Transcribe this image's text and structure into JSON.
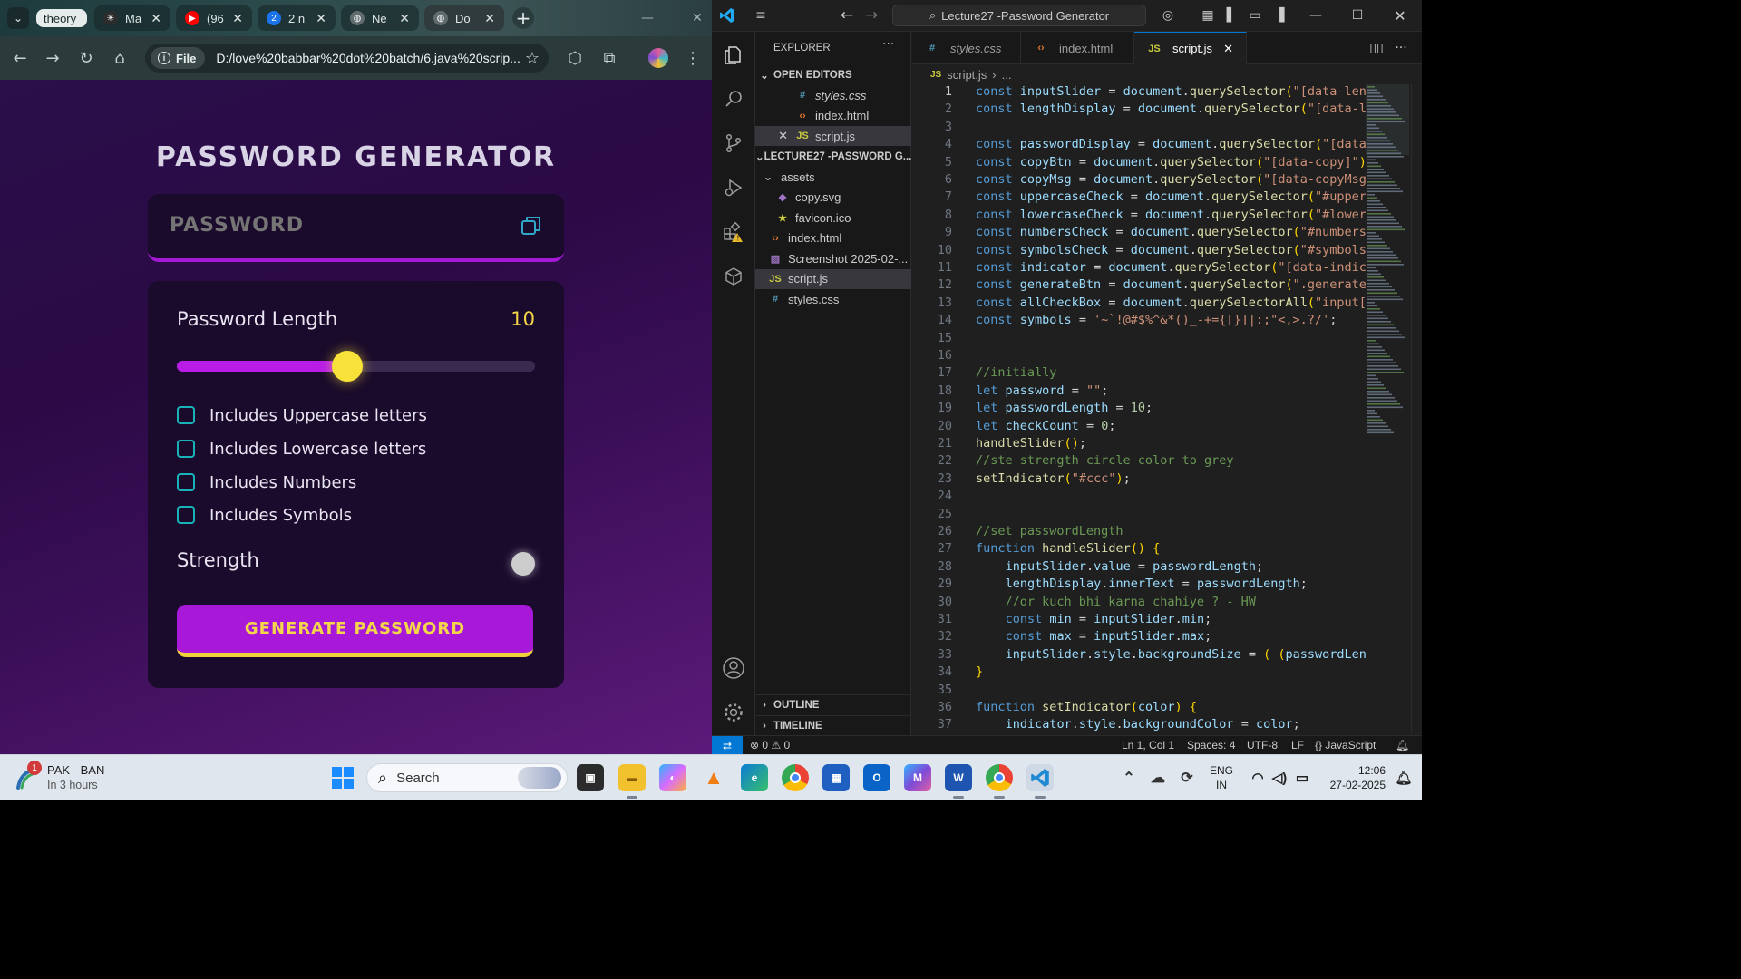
{
  "browser": {
    "tabs": [
      {
        "label": "theory",
        "type": "group"
      },
      {
        "label": "Ma",
        "icon": "openai-icon"
      },
      {
        "label": "(96",
        "icon": "youtube-icon"
      },
      {
        "label": "2 n",
        "icon": "count-badge-icon",
        "badge": "2"
      },
      {
        "label": "Ne",
        "icon": "globe-icon"
      },
      {
        "label": "Do",
        "icon": "globe-icon",
        "active": true
      }
    ],
    "omnibox": {
      "scheme_chip": "File",
      "url": "D:/love%20babbar%20dot%20batch/6.java%20scrip..."
    }
  },
  "app": {
    "title": "PASSWORD GENERATOR",
    "password_placeholder": "PASSWORD",
    "length_label": "Password Length",
    "length_value": "10",
    "slider_fraction": 0.475,
    "options": [
      {
        "label": "Includes Uppercase letters",
        "checked": false
      },
      {
        "label": "Includes Lowercase letters",
        "checked": false
      },
      {
        "label": "Includes Numbers",
        "checked": false
      },
      {
        "label": "Includes Symbols",
        "checked": false
      }
    ],
    "strength_label": "Strength",
    "strength_color": "#cccccc",
    "generate_label": "GENERATE PASSWORD"
  },
  "vscode": {
    "search": "Lecture27 -Password Generator",
    "explorer_title": "EXPLORER",
    "open_editors_label": "OPEN EDITORS",
    "open_editors": [
      {
        "name": "styles.css",
        "icon": "#",
        "italic": true
      },
      {
        "name": "index.html",
        "icon": "<>"
      },
      {
        "name": "script.js",
        "icon": "JS",
        "selected": true
      }
    ],
    "folder_label": "LECTURE27 -PASSWORD G...",
    "tree": [
      {
        "name": "assets",
        "folder": true
      },
      {
        "name": "copy.svg",
        "icon": "svg"
      },
      {
        "name": "favicon.ico",
        "icon": "star"
      },
      {
        "name": "index.html",
        "icon": "<>"
      },
      {
        "name": "Screenshot 2025-02-...",
        "icon": "img"
      },
      {
        "name": "script.js",
        "icon": "JS",
        "selected": true
      },
      {
        "name": "styles.css",
        "icon": "#"
      }
    ],
    "outline_label": "OUTLINE",
    "timeline_label": "TIMELINE",
    "editor_tabs": [
      {
        "name": "styles.css",
        "icon": "#"
      },
      {
        "name": "index.html",
        "icon": "<>"
      },
      {
        "name": "script.js",
        "icon": "JS",
        "active": true
      }
    ],
    "breadcrumb": [
      "script.js",
      "..."
    ],
    "code_lines": [
      "const inputSlider = document.querySelector(\"[data-leng",
      "const lengthDisplay = document.querySelector(\"[data-le",
      "",
      "const passwordDisplay = document.querySelector(\"[data-",
      "const copyBtn = document.querySelector(\"[data-copy]\");",
      "const copyMsg = document.querySelector(\"[data-copyMsg]",
      "const uppercaseCheck = document.querySelector(\"#upperc",
      "const lowercaseCheck = document.querySelector(\"#lowerc",
      "const numbersCheck = document.querySelector(\"#numbers\"",
      "const symbolsCheck = document.querySelector(\"#symbols\"",
      "const indicator = document.querySelector(\"[data-indica",
      "const generateBtn = document.querySelector(\".generateB",
      "const allCheckBox = document.querySelectorAll(\"input[t",
      "const symbols = '~`!@#$%^&*()_-+={[}]|:;\"<,>.?/';",
      "",
      "",
      "//initially",
      "let password = \"\";",
      "let passwordLength = 10;",
      "let checkCount = 0;",
      "handleSlider();",
      "//ste strength circle color to grey",
      "setIndicator(\"#ccc\");",
      "",
      "",
      "//set passwordLength",
      "function handleSlider() {",
      "    inputSlider.value = passwordLength;",
      "    lengthDisplay.innerText = passwordLength;",
      "    //or kuch bhi karna chahiye ? - HW",
      "    const min = inputSlider.min;",
      "    const max = inputSlider.max;",
      "    inputSlider.style.backgroundSize = ( (passwordLeng",
      "}",
      "",
      "function setIndicator(color) {",
      "    indicator.style.backgroundColor = color;"
    ],
    "status": {
      "errors": "0",
      "warnings": "0",
      "position": "Ln 1, Col 1",
      "spaces": "Spaces: 4",
      "encoding": "UTF-8",
      "eol": "LF",
      "language": "JavaScript"
    }
  },
  "taskbar": {
    "weather_title": "PAK - BAN",
    "weather_sub": "In 3 hours",
    "weather_badge": "1",
    "search_placeholder": "Search",
    "lang_top": "ENG",
    "lang_bottom": "IN",
    "time": "12:06",
    "date": "27-02-2025"
  }
}
